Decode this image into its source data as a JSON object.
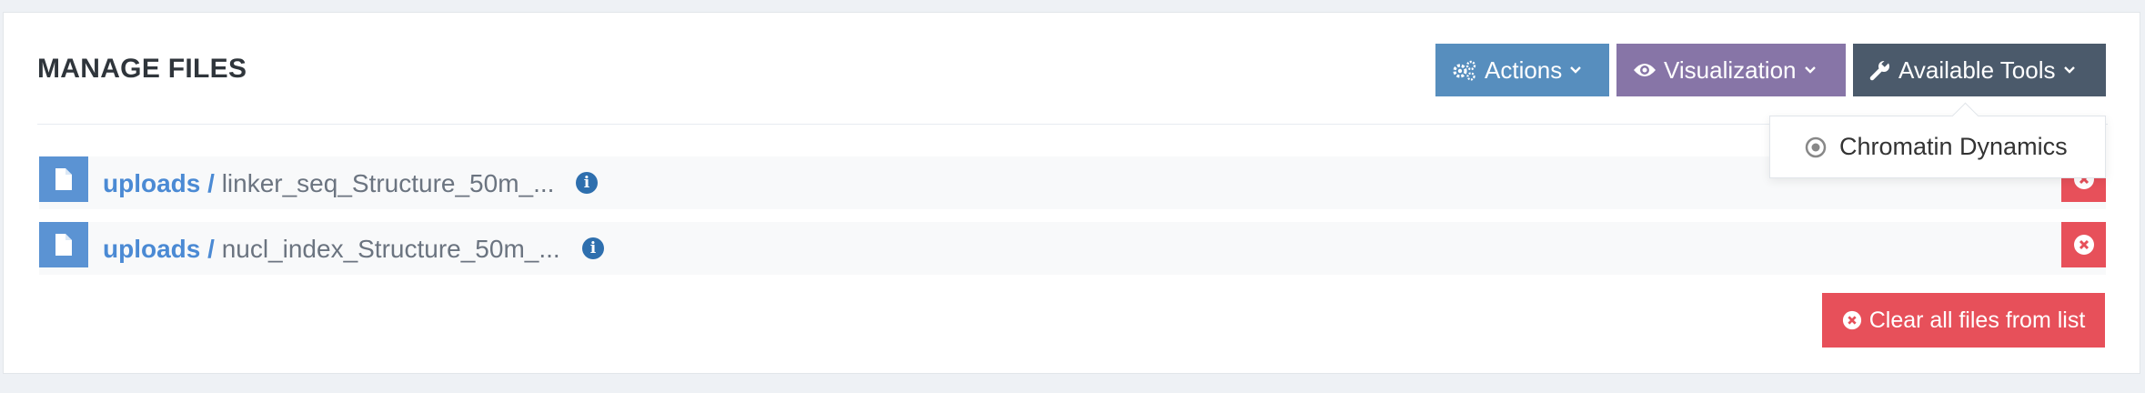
{
  "panel": {
    "title": "MANAGE FILES"
  },
  "toolbar": {
    "actions_label": "Actions",
    "visualization_label": "Visualization",
    "tools_label": "Available Tools"
  },
  "tools_menu": {
    "items": [
      {
        "label": "Chromatin Dynamics"
      }
    ]
  },
  "files": [
    {
      "folder": "uploads /",
      "name": "linker_seq_Structure_50m_..."
    },
    {
      "folder": "uploads /",
      "name": "nucl_index_Structure_50m_..."
    }
  ],
  "clear_label": "Clear all files from list",
  "colors": {
    "actions": "#578ebe",
    "visualization": "#8775a7",
    "tools": "#4b5a6b",
    "danger": "#e7505a",
    "file_tile": "#5b93d3"
  },
  "icons": [
    "gears-icon",
    "eye-icon",
    "wrench-icon",
    "chevron-down-icon",
    "circle-dot-icon",
    "file-icon",
    "info-icon",
    "remove-icon"
  ]
}
